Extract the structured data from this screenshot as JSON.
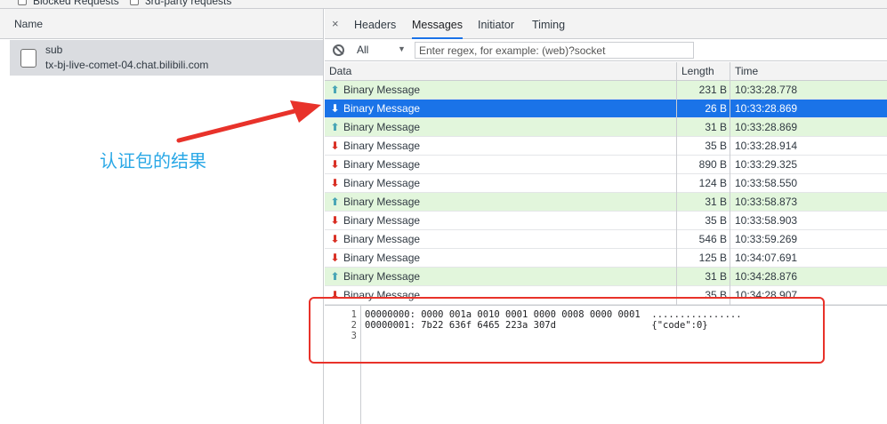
{
  "top_filter": {
    "blocked_requests_label": "Blocked Requests",
    "third_party_label": "3rd-party requests"
  },
  "left_pane": {
    "column_header": "Name",
    "request": {
      "name": "sub",
      "url": "tx-bj-live-comet-04.chat.bilibili.com"
    }
  },
  "annotation": {
    "label": "认证包的结果",
    "arrow_color": "#e8322a",
    "label_color": "#2aa8e6"
  },
  "tabs": {
    "close_glyph": "×",
    "items": [
      {
        "label": "Headers",
        "active": false
      },
      {
        "label": "Messages",
        "active": true
      },
      {
        "label": "Initiator",
        "active": false
      },
      {
        "label": "Timing",
        "active": false
      }
    ]
  },
  "filter": {
    "selected": "All",
    "placeholder": "Enter regex, for example: (web)?socket"
  },
  "grid": {
    "headers": {
      "data": "Data",
      "length": "Length",
      "time": "Time"
    },
    "rows": [
      {
        "dir": "up",
        "data": "Binary Message",
        "length": "231 B",
        "time": "10:33:28.778"
      },
      {
        "dir": "down",
        "data": "Binary Message",
        "length": "26 B",
        "time": "10:33:28.869",
        "selected": true
      },
      {
        "dir": "up",
        "data": "Binary Message",
        "length": "31 B",
        "time": "10:33:28.869"
      },
      {
        "dir": "down",
        "data": "Binary Message",
        "length": "35 B",
        "time": "10:33:28.914"
      },
      {
        "dir": "down",
        "data": "Binary Message",
        "length": "890 B",
        "time": "10:33:29.325"
      },
      {
        "dir": "down",
        "data": "Binary Message",
        "length": "124 B",
        "time": "10:33:58.550"
      },
      {
        "dir": "up",
        "data": "Binary Message",
        "length": "31 B",
        "time": "10:33:58.873"
      },
      {
        "dir": "down",
        "data": "Binary Message",
        "length": "35 B",
        "time": "10:33:58.903"
      },
      {
        "dir": "down",
        "data": "Binary Message",
        "length": "546 B",
        "time": "10:33:59.269"
      },
      {
        "dir": "down",
        "data": "Binary Message",
        "length": "125 B",
        "time": "10:34:07.691"
      },
      {
        "dir": "up",
        "data": "Binary Message",
        "length": "31 B",
        "time": "10:34:28.876"
      },
      {
        "dir": "down",
        "data": "Binary Message",
        "length": "35 B",
        "time": "10:34:28.907"
      }
    ],
    "colors": {
      "sent": "#e2f6dc",
      "selected": "#1a73e8",
      "up_arrow": "#4aa6b6",
      "down_arrow": "#d93025"
    }
  },
  "viewer": {
    "lines": [
      {
        "num": "1",
        "text": "00000000: 0000 001a 0010 0001 0000 0008 0000 0001  ................"
      },
      {
        "num": "2",
        "text": "00000001: 7b22 636f 6465 223a 307d                 {\"code\":0}"
      },
      {
        "num": "3",
        "text": ""
      }
    ],
    "highlight_color": "#e8322a"
  }
}
